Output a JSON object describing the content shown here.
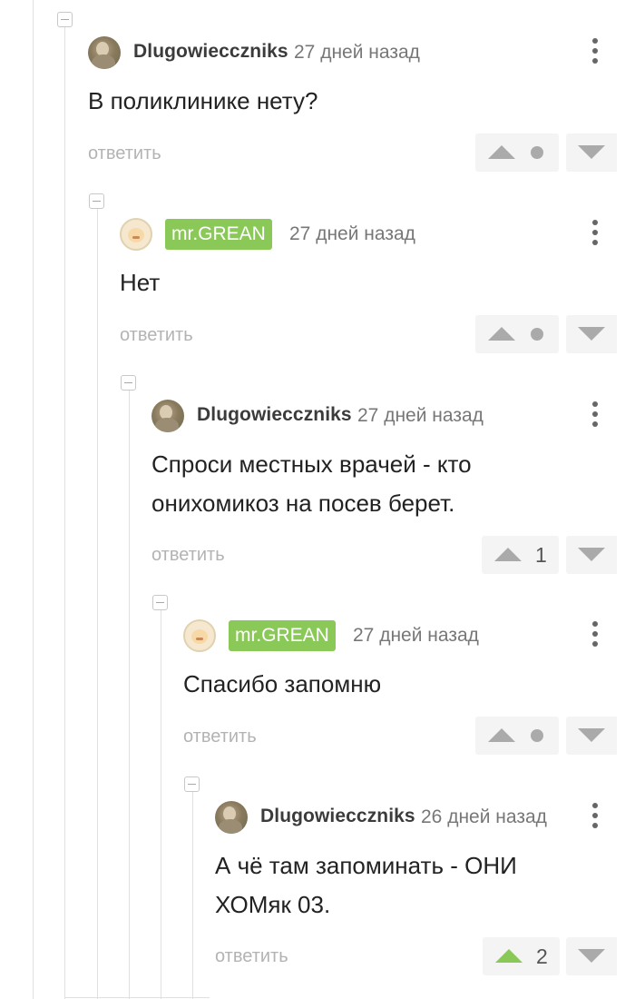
{
  "thread": {
    "reply_label": "ответить",
    "comments": [
      {
        "author": "Dlugowiecczniks",
        "time": "27 дней назад",
        "text": "В поликлинике нету?",
        "rating": "",
        "avatar": "photo-avatar"
      },
      {
        "author": "mr.GREAN",
        "time": "27 дней назад",
        "text": "Нет",
        "rating": "",
        "avatar": "emoji-avatar"
      },
      {
        "author": "Dlugowiecczniks",
        "time": "27 дней назад",
        "text": "Спроси местных врачей - кто онихомикоз на посев берет.",
        "rating": "1",
        "avatar": "photo-avatar"
      },
      {
        "author": "mr.GREAN",
        "time": "27 дней назад",
        "text": "Спасибо запомню",
        "rating": "",
        "avatar": "emoji-avatar"
      },
      {
        "author": "Dlugowiecczniks",
        "time": "26 дней назад",
        "text": "А чё там запоминать - ОНИ ХОМяк 03.",
        "rating": "2",
        "avatar": "photo-avatar"
      }
    ]
  },
  "colors": {
    "badge_green": "#8ac858",
    "upvote_active": "#8ac858",
    "muted": "#b3b3b3"
  },
  "icons": [
    "collapse-icon",
    "kebab-menu-icon",
    "upvote-icon",
    "downvote-icon",
    "neutral-rating-dot"
  ]
}
